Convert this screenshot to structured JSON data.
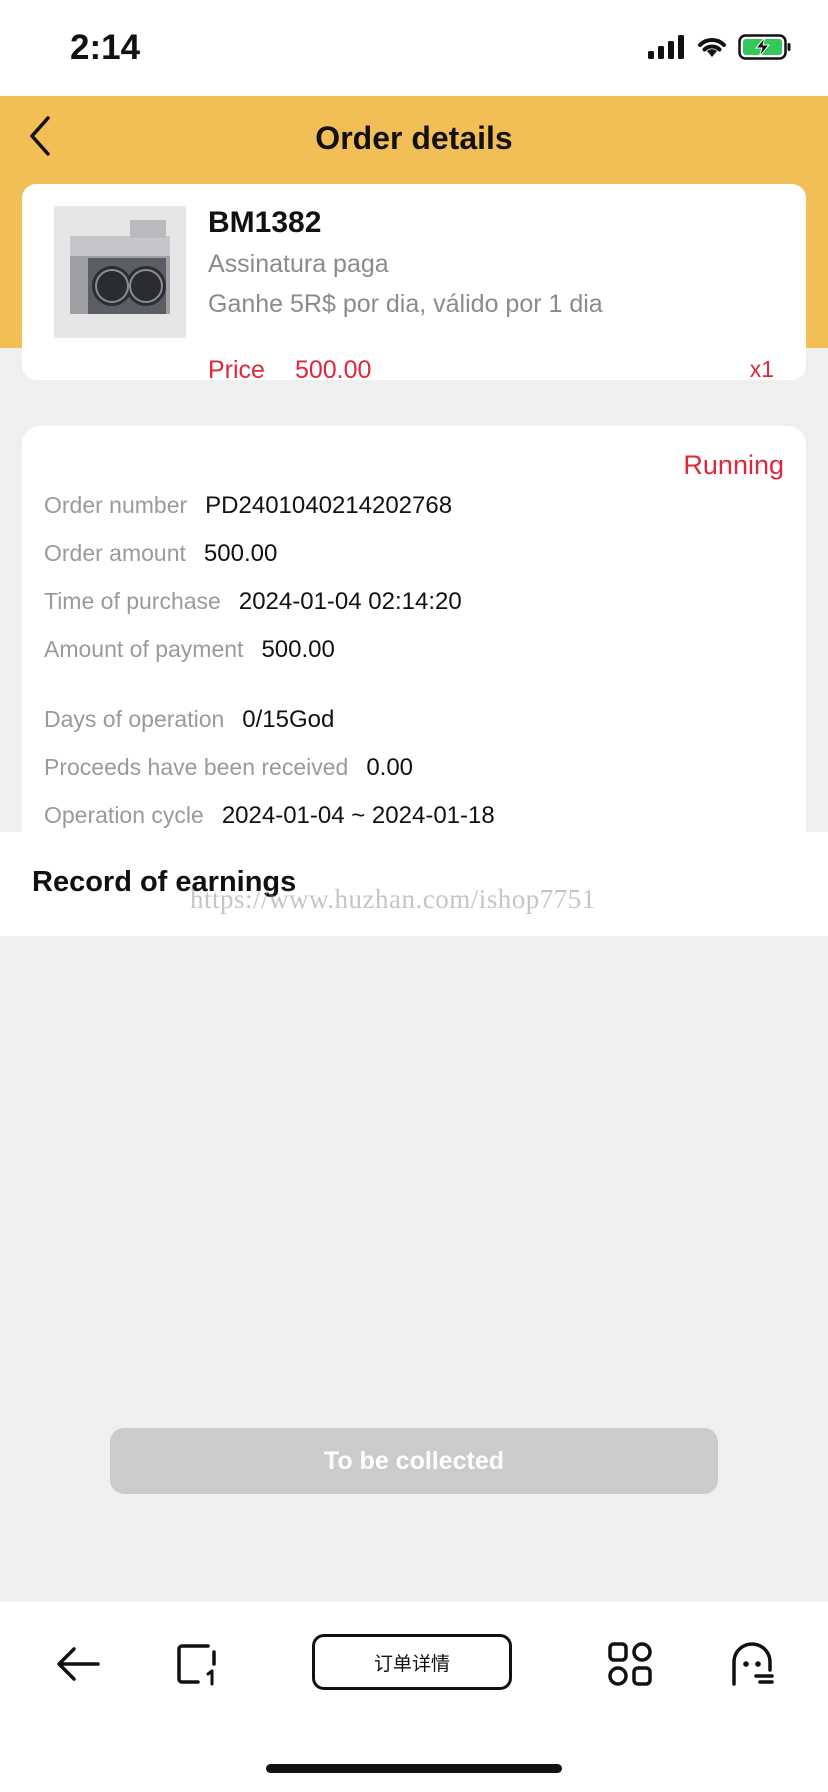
{
  "status_bar": {
    "time": "2:14"
  },
  "header": {
    "title": "Order details"
  },
  "product": {
    "name": "BM1382",
    "subtitle": "Assinatura paga",
    "description": "Ganhe 5R$ por dia, válido por 1 dia",
    "price_label": "Price",
    "price_value": "500.00",
    "quantity": "x1"
  },
  "order": {
    "status": "Running",
    "rows": [
      {
        "label": "Order number",
        "value": "PD2401040214202768"
      },
      {
        "label": "Order amount",
        "value": "500.00"
      },
      {
        "label": "Time of purchase",
        "value": "2024-01-04 02:14:20"
      },
      {
        "label": "Amount of payment",
        "value": "500.00"
      },
      {
        "label": "Days of operation",
        "value": "0/15God"
      },
      {
        "label": "Proceeds have been received",
        "value": "0.00"
      },
      {
        "label": "Operation cycle",
        "value": "2024-01-04 ~ 2024-01-18"
      }
    ]
  },
  "earnings": {
    "title": "Record of earnings"
  },
  "watermark": "https://www.huzhan.com/ishop7751",
  "collect_button": "To be collected",
  "toolbar": {
    "page_label": "订单详情"
  },
  "colors": {
    "accent": "#f2bf57",
    "status_red": "#e0263a",
    "disabled_button": "#cbcbcb"
  }
}
